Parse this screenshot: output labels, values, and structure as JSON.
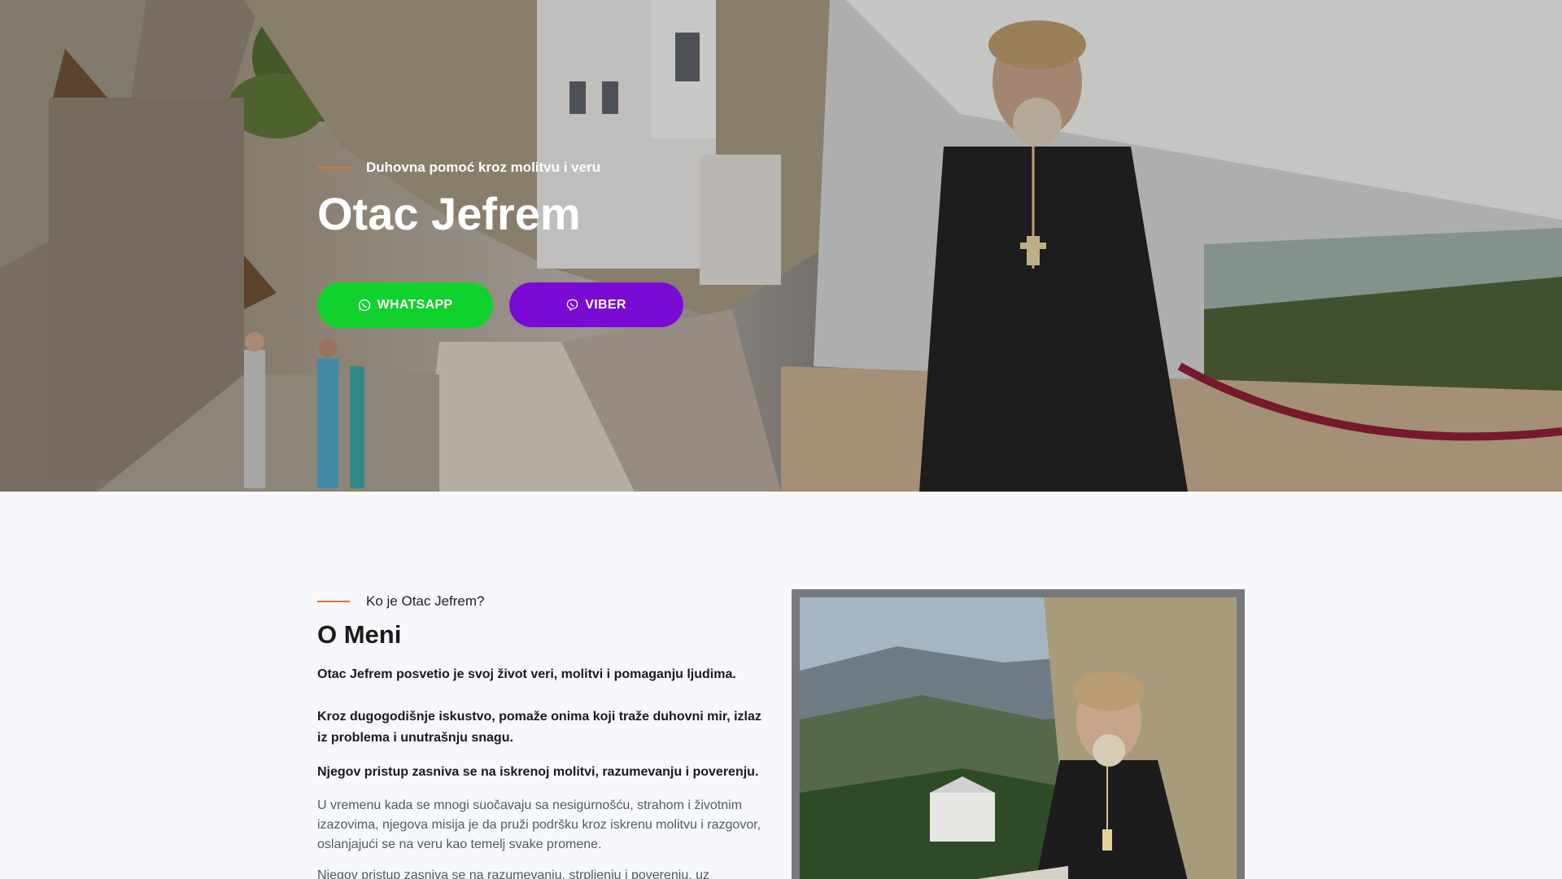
{
  "hero": {
    "eyebrow": "Duhovna pomoć kroz molitvu i veru",
    "title": "Otac Jefrem",
    "buttons": {
      "whatsapp_label": "WHATSAPP",
      "viber_label": "VIBER",
      "whatsapp_icon": "whatsapp-icon",
      "viber_icon": "viber-icon",
      "whatsapp_color": "#11d12c",
      "viber_color": "#7a0bd4"
    }
  },
  "about": {
    "eyebrow": "Ko je Otac Jefrem?",
    "title": "O Meni",
    "p1": "Otac Jefrem posvetio je svoj život veri, molitvi i pomaganju ljudima.",
    "p2": "Kroz dugogodišnje iskustvo, pomaže onima koji traže duhovni mir, izlaz iz problema i unutrašnju snagu.",
    "p3": "Njegov pristup zasniva se na iskrenoj molitvi, razumevanju i poverenju.",
    "p4": "U vremenu kada se mnogi suočavaju sa nesigurnošću, strahom i životnim izazovima, njegova misija je da pruži podršku kroz iskrenu molitvu i razgovor, oslanjajući se na veru kao temelj svake promene.",
    "p5": "Njegov pristup zasniva se na razumevanju, strpljenju i poverenju, uz"
  },
  "colors": {
    "accent": "#e8722c",
    "page_bg": "#f6f8fb"
  }
}
